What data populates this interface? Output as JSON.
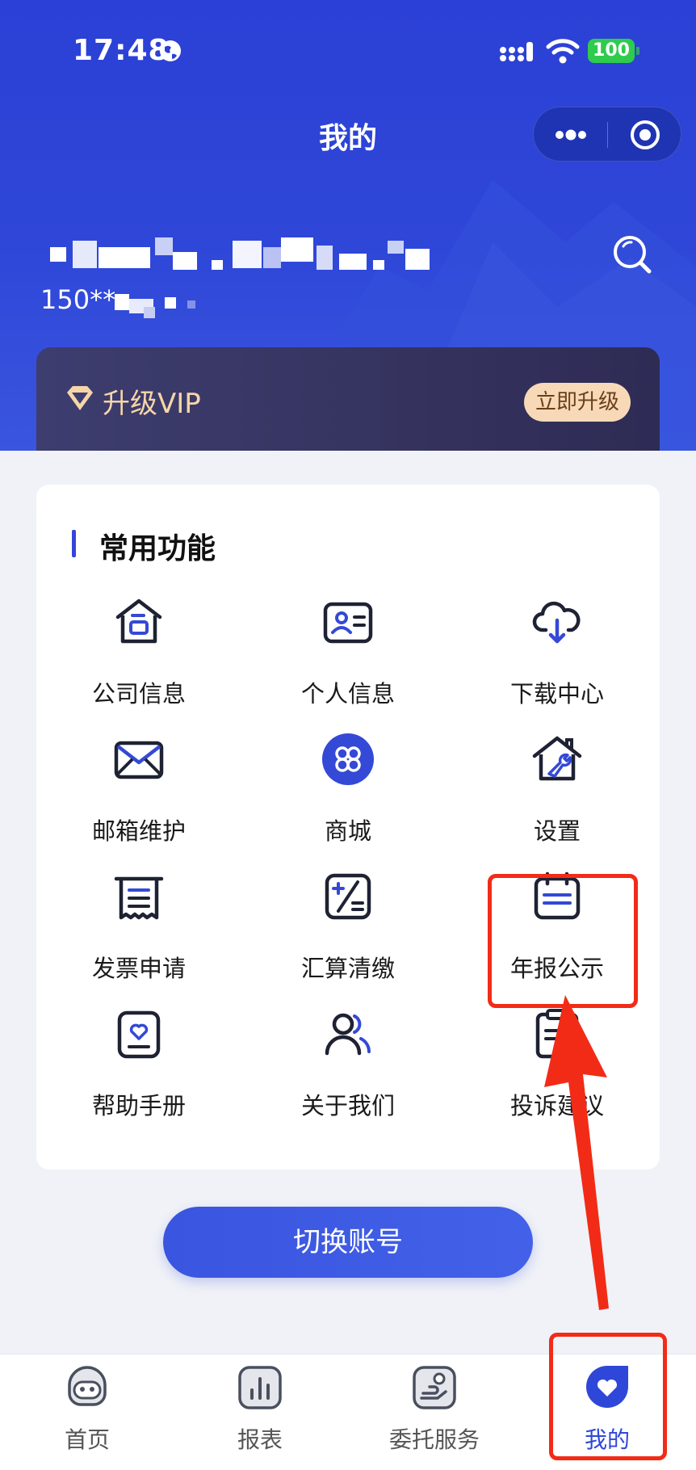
{
  "status_bar": {
    "time": "17:48",
    "battery": "100"
  },
  "header": {
    "title": "我的"
  },
  "user": {
    "phone": "150**"
  },
  "vip": {
    "label": "升级VIP",
    "button": "立即升级"
  },
  "functions": {
    "title": "常用功能",
    "items": [
      {
        "label": "公司信息",
        "icon": "company-house-icon"
      },
      {
        "label": "个人信息",
        "icon": "id-card-icon"
      },
      {
        "label": "下载中心",
        "icon": "cloud-download-icon"
      },
      {
        "label": "邮箱维护",
        "icon": "mail-icon"
      },
      {
        "label": "商城",
        "icon": "shop-grid-icon"
      },
      {
        "label": "设置",
        "icon": "house-wrench-icon"
      },
      {
        "label": "发票申请",
        "icon": "receipt-icon"
      },
      {
        "label": "汇算清缴",
        "icon": "calculator-icon"
      },
      {
        "label": "年报公示",
        "icon": "calendar-icon"
      },
      {
        "label": "帮助手册",
        "icon": "help-heart-icon"
      },
      {
        "label": "关于我们",
        "icon": "users-icon"
      },
      {
        "label": "投诉建议",
        "icon": "clipboard-pen-icon"
      }
    ]
  },
  "switch_account": {
    "label": "切换账号"
  },
  "tabbar": {
    "items": [
      {
        "label": "首页",
        "icon": "robot-icon"
      },
      {
        "label": "报表",
        "icon": "bar-chart-icon"
      },
      {
        "label": "委托服务",
        "icon": "hand-coin-icon"
      },
      {
        "label": "我的",
        "icon": "heart-icon",
        "active": true
      }
    ]
  },
  "colors": {
    "primary": "#2f47d8",
    "vip_text": "#f6d5a8",
    "annotation": "#f22b17"
  }
}
